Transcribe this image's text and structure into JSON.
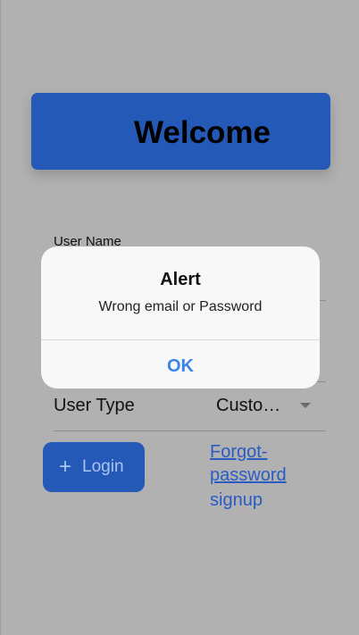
{
  "header": {
    "title": "Welcome"
  },
  "form": {
    "username_label": "User Name",
    "user_type_label": "User Type",
    "user_type_value": "Customer",
    "login_label": "Login",
    "forgot_password_link": "Forgot-password",
    "signup_link": "signup"
  },
  "alert": {
    "title": "Alert",
    "message": "Wrong email or Password",
    "ok_label": "OK"
  },
  "colors": {
    "backdrop": "#b1b1b1",
    "primary": "#2459b8",
    "link": "#2a5cc3",
    "alert_action": "#3a86e8"
  },
  "icons": {
    "login_icon": "plus-icon",
    "dropdown_icon": "dropdown-arrow-icon"
  }
}
